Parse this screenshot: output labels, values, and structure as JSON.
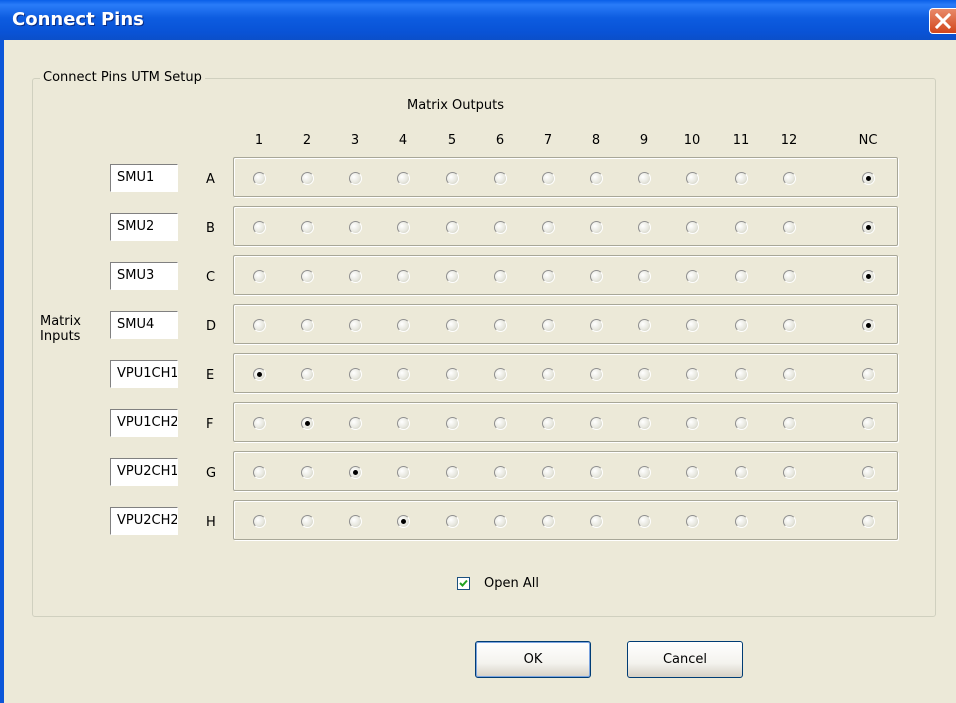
{
  "window": {
    "title": "Connect Pins"
  },
  "group": {
    "label": "Connect Pins UTM Setup"
  },
  "matrix_outputs_label": "Matrix Outputs",
  "matrix_inputs_label_line1": "Matrix",
  "matrix_inputs_label_line2": "Inputs",
  "columns": [
    "1",
    "2",
    "3",
    "4",
    "5",
    "6",
    "7",
    "8",
    "9",
    "10",
    "11",
    "12",
    "NC"
  ],
  "rows": [
    {
      "name": "SMU1",
      "letter": "A",
      "selected": "NC"
    },
    {
      "name": "SMU2",
      "letter": "B",
      "selected": "NC"
    },
    {
      "name": "SMU3",
      "letter": "C",
      "selected": "NC"
    },
    {
      "name": "SMU4",
      "letter": "D",
      "selected": "NC"
    },
    {
      "name": "VPU1CH1",
      "letter": "E",
      "selected": "1"
    },
    {
      "name": "VPU1CH2",
      "letter": "F",
      "selected": "2"
    },
    {
      "name": "VPU2CH1",
      "letter": "G",
      "selected": "3"
    },
    {
      "name": "VPU2CH2",
      "letter": "H",
      "selected": "4"
    }
  ],
  "open_all": {
    "label": "Open All",
    "checked": true
  },
  "buttons": {
    "ok": "OK",
    "cancel": "Cancel"
  },
  "colors": {
    "titlebar": "#0b56d9",
    "close": "#d2461c",
    "face": "#ece9d8"
  }
}
